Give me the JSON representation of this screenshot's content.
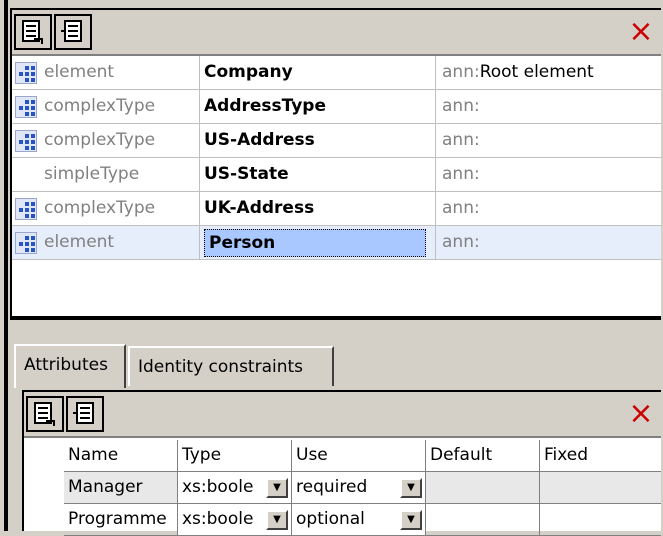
{
  "toolbar": {
    "buttons": [
      "append-icon",
      "insert-icon"
    ],
    "close": "×"
  },
  "components": [
    {
      "kind": "element",
      "name": "Company",
      "ann_prefix": "ann:",
      "ann_text": "Root element",
      "icon": "component-icon"
    },
    {
      "kind": "complexType",
      "name": "AddressType",
      "ann_prefix": "ann:",
      "ann_text": "",
      "icon": "component-icon"
    },
    {
      "kind": "complexType",
      "name": "US-Address",
      "ann_prefix": "ann:",
      "ann_text": "",
      "icon": "component-icon"
    },
    {
      "kind": "simpleType",
      "name": "US-State",
      "ann_prefix": "ann:",
      "ann_text": "",
      "icon": ""
    },
    {
      "kind": "complexType",
      "name": "UK-Address",
      "ann_prefix": "ann:",
      "ann_text": "",
      "icon": "component-icon"
    },
    {
      "kind": "element",
      "name": "Person",
      "ann_prefix": "ann:",
      "ann_text": "",
      "icon": "component-icon",
      "selected": true
    }
  ],
  "tabs": [
    {
      "label": "Attributes",
      "active": true
    },
    {
      "label": "Identity constraints",
      "active": false
    }
  ],
  "attributes": {
    "columns": [
      "Name",
      "Type",
      "Use",
      "Default",
      "Fixed"
    ],
    "rows": [
      {
        "name": "Manager",
        "type": "xs:boole",
        "use": "required",
        "default": "",
        "fixed": ""
      },
      {
        "name": "Programme",
        "type": "xs:boole",
        "use": "optional",
        "default": "",
        "fixed": ""
      }
    ]
  }
}
